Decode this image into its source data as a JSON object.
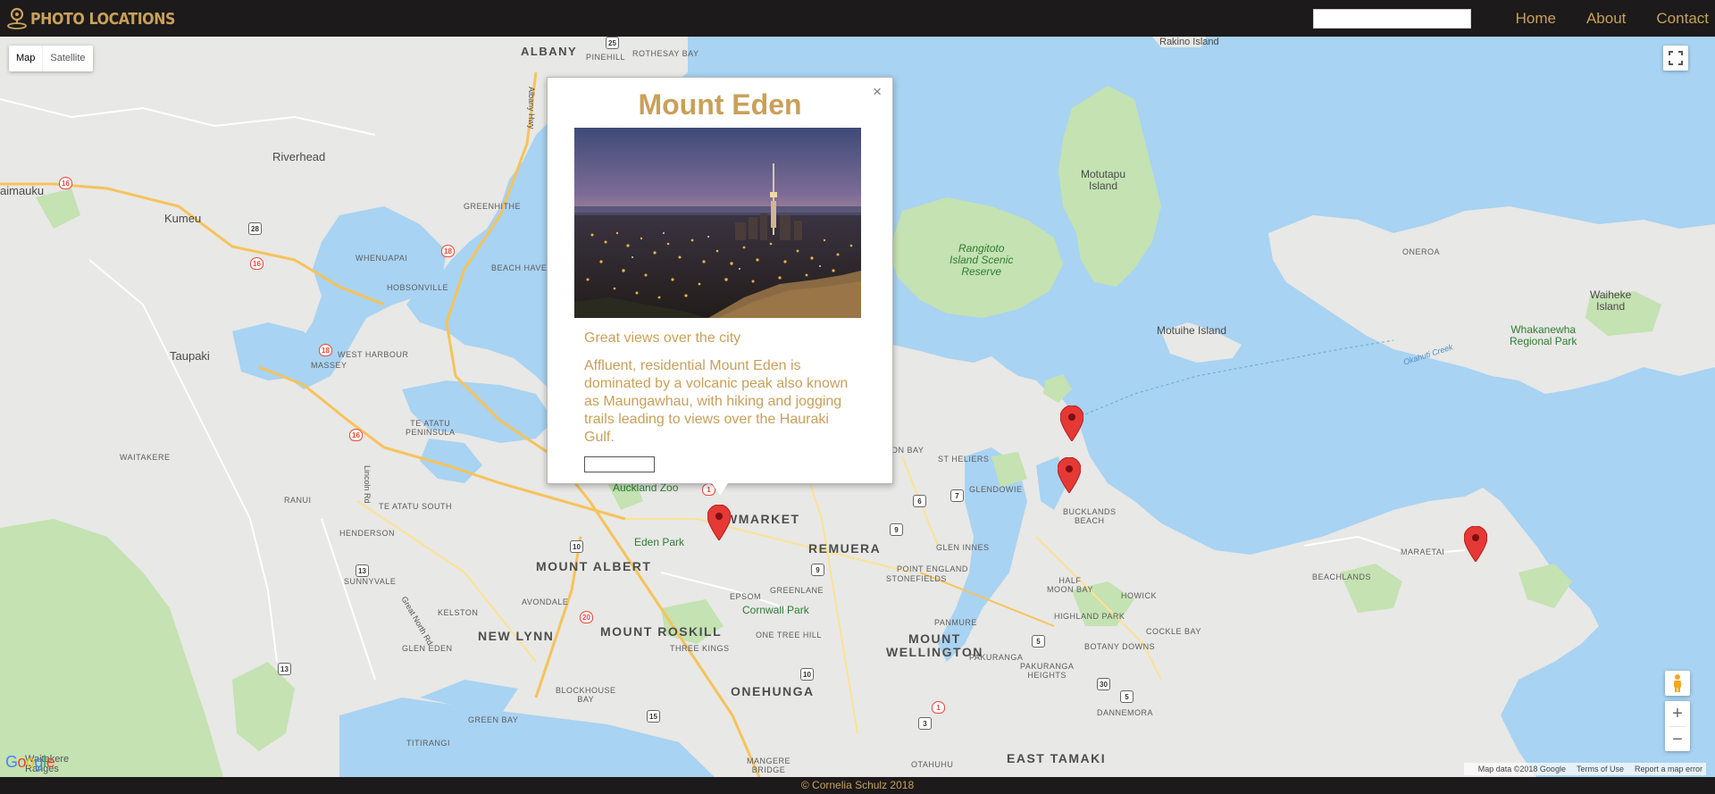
{
  "navbar": {
    "brand": "Photo Locations",
    "search_placeholder": "",
    "links": [
      "Home",
      "About",
      "Contact"
    ]
  },
  "map": {
    "type_controls": [
      "Map",
      "Satellite"
    ],
    "active_type": "Map",
    "labels": {
      "albany": "ALBANY",
      "riverhead": "Riverhead",
      "kumeu": "Kumeu",
      "waimauku": "aimauku",
      "taupaki": "Taupaki",
      "waitakere": "WAITAKERE",
      "ranui": "RANUI",
      "henderson": "HENDERSON",
      "sunnyvale": "SUNNYVALE",
      "glen_eden": "GLEN EDEN",
      "green_bay": "GREEN BAY",
      "titirangi": "TITIRANGI",
      "kelston": "KELSTON",
      "new_lynn": "NEW LYNN",
      "avondale": "AVONDALE",
      "blockhouse_bay": "BLOCKHOUSE\nBAY",
      "mount_albert": "MOUNT ALBERT",
      "mount_roskill": "MOUNT ROSKILL",
      "three_kings": "THREE KINGS",
      "onehunga": "ONEHUNGA",
      "mangere_bridge": "MANGERE\nBRIDGE",
      "epsom": "EPSOM",
      "greenlane": "GREENLANE",
      "one_tree_hill": "ONE TREE HILL",
      "remuera": "REMUERA",
      "newmarket": "WMARKET",
      "stonefields": "STONEFIELDS",
      "point_england": "POINT ENGLAND",
      "glen_innes": "GLEN INNES",
      "mount_wellington": "MOUNT\nWELLINGTON",
      "panmure": "PANMURE",
      "pakuranga": "PAKURANGA",
      "pakuranga_heights": "PAKURANGA\nHEIGHTS",
      "otahuhu": "OTAHUHU",
      "east_tamaki": "EAST TAMAKI",
      "highland_park": "HIGHLAND PARK",
      "half_moon_bay": "HALF\nMOON BAY",
      "howick": "HOWICK",
      "cockle_bay": "COCKLE BAY",
      "botany_downs": "BOTANY DOWNS",
      "dannemora": "DANNEMORA",
      "bucklands_beach": "BUCKLANDS\nBEACH",
      "st_heliers": "ST HELIERS",
      "glendowie": "GLENDOWIE",
      "beachlands": "BEACHLANDS",
      "maraetai": "MARAETAI",
      "te_atatu_peninsula": "TE ATATU\nPENINSULA",
      "te_atatu_south": "TE ATATU SOUTH",
      "massey": "MASSEY",
      "west_harbour": "WEST HARBOUR",
      "hobsonville": "HOBSONVILLE",
      "whenuapai": "WHENUAPAI",
      "greenhithe": "GREENHITHE",
      "beach_haven": "BEACH HAVEN",
      "pinehill": "PINEHILL",
      "rothesay_bay": "ROTHESAY BAY",
      "motutapu": "Motutapu\nIsland",
      "rangitoto": "Rangitoto\nIsland Scenic\nReserve",
      "motuihe": "Motuihe Island",
      "waiheke": "Waiheke\nIsland",
      "whakanewha": "Whakanewha\nRegional Park",
      "oneroa": "ONEROA",
      "rakino": "Rakino Island",
      "auckland_zoo": "Auckland Zoo",
      "eden_park": "Eden Park",
      "cornwall_park": "Cornwall Park",
      "albany_hwy": "Albany Hwy",
      "lincoln_rd": "Lincoln Rd",
      "great_north_rd": "Great North Rd",
      "okahuti_creek": "Okahuti Creek",
      "on_bay": "ON BAY",
      "waitakere_ranges": "Waitakere\nRanges"
    },
    "shields": {
      "s16a": "16",
      "s28": "28",
      "s16b": "16",
      "s18": "18",
      "s18b": "18",
      "s16c": "16",
      "s25": "25",
      "s10": "10",
      "s13a": "13",
      "s13b": "13",
      "s20": "20",
      "s15": "15",
      "s9a": "9",
      "s9b": "9",
      "s6": "6",
      "s7": "7",
      "s10b": "10",
      "s5a": "5",
      "s5b": "5",
      "s30": "30",
      "s3": "3",
      "s1": "1",
      "s1b": "1"
    },
    "google_logo": "Google",
    "attribution": [
      "Map data ©2018 Google",
      "Terms of Use",
      "Report a map error"
    ],
    "marker_count": 4
  },
  "info_window": {
    "title": "Mount Eden",
    "subtitle": "Great views over the city",
    "description": "Affluent, residential Mount Eden is dominated by a volcanic peak also known as Maungawhau, with hiking and jogging trails leading to views over the Hauraki Gulf.",
    "input_value": "",
    "close_label": "×"
  },
  "footer": {
    "text": "© Cornelia Schulz 2018"
  },
  "colors": {
    "brand_gold": "#c9a05a",
    "navbar_bg": "#1c1a1a",
    "water": "#a8d3f2",
    "land": "#e8e8e6",
    "park": "#c4e2b2",
    "marker_red": "#e53935"
  }
}
